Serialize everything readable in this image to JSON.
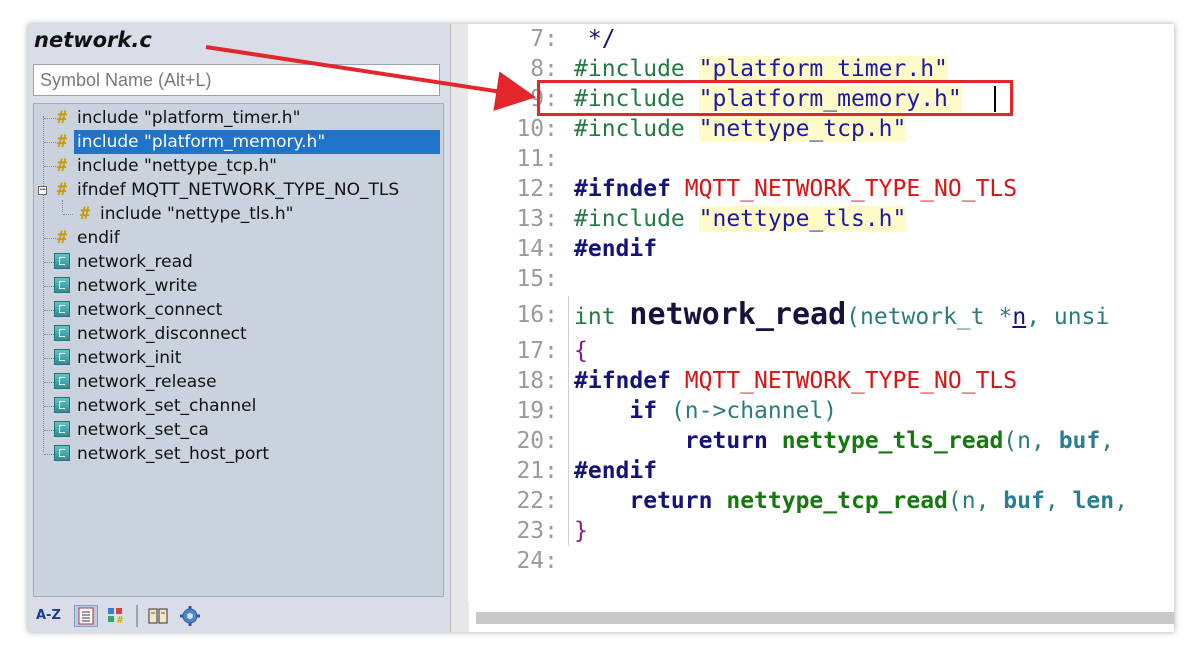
{
  "sidebar": {
    "file_title": "network.c",
    "search_placeholder": "Symbol Name (Alt+L)",
    "items": [
      {
        "label": "include \"platform_timer.h\"",
        "kind": "include"
      },
      {
        "label": "include \"platform_memory.h\"",
        "kind": "include",
        "selected": true
      },
      {
        "label": "include \"nettype_tcp.h\"",
        "kind": "include"
      },
      {
        "label": "ifndef MQTT_NETWORK_TYPE_NO_TLS",
        "kind": "ifndef"
      },
      {
        "label": "include \"nettype_tls.h\"",
        "kind": "include"
      },
      {
        "label": "endif",
        "kind": "endif"
      },
      {
        "label": "network_read",
        "kind": "function"
      },
      {
        "label": "network_write",
        "kind": "function"
      },
      {
        "label": "network_connect",
        "kind": "function"
      },
      {
        "label": "network_disconnect",
        "kind": "function"
      },
      {
        "label": "network_init",
        "kind": "function"
      },
      {
        "label": "network_release",
        "kind": "function"
      },
      {
        "label": "network_set_channel",
        "kind": "function"
      },
      {
        "label": "network_set_ca",
        "kind": "function"
      },
      {
        "label": "network_set_host_port",
        "kind": "function"
      }
    ],
    "toolbar": {
      "sort_az": "A-Z"
    }
  },
  "editor": {
    "lines": [
      {
        "n": "7:",
        "text": " */"
      },
      {
        "n": "8:",
        "text": "#include \"platform_timer.h\""
      },
      {
        "n": "9:",
        "text": "#include \"platform_memory.h\""
      },
      {
        "n": "10:",
        "text": "#include \"nettype_tcp.h\""
      },
      {
        "n": "11:",
        "text": ""
      },
      {
        "n": "12:",
        "text": "#ifndef MQTT_NETWORK_TYPE_NO_TLS"
      },
      {
        "n": "13:",
        "text": "#include \"nettype_tls.h\""
      },
      {
        "n": "14:",
        "text": "#endif"
      },
      {
        "n": "15:",
        "text": ""
      },
      {
        "n": "16:",
        "text": "int network_read(network_t *n, unsi"
      },
      {
        "n": "17:",
        "text": "{"
      },
      {
        "n": "18:",
        "text": "#ifndef MQTT_NETWORK_TYPE_NO_TLS"
      },
      {
        "n": "19:",
        "text": "    if (n->channel)"
      },
      {
        "n": "20:",
        "text": "        return nettype_tls_read(n, buf,"
      },
      {
        "n": "21:",
        "text": "#endif"
      },
      {
        "n": "22:",
        "text": "    return nettype_tcp_read(n, buf, len,"
      },
      {
        "n": "23:",
        "text": "}"
      },
      {
        "n": "24:",
        "text": ""
      }
    ]
  },
  "colors": {
    "selection": "#1f73c9",
    "annotation_red": "#e3262b",
    "macro_red": "#d81414",
    "string_bg": "#fffbc8",
    "function_green": "#16780f"
  }
}
